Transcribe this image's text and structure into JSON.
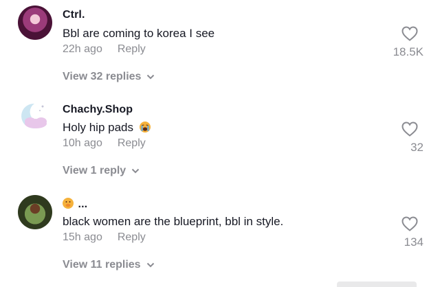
{
  "comments": [
    {
      "username": "Ctrl.",
      "text": "Bbl are coming to korea I see",
      "time": "22h ago",
      "reply_label": "Reply",
      "likes": "18.5K",
      "view_replies": "View 32 replies"
    },
    {
      "username": "Chachy.Shop",
      "text": "Holy hip pads",
      "time": "10h ago",
      "reply_label": "Reply",
      "likes": "32",
      "view_replies": "View 1 reply"
    },
    {
      "username": "...",
      "text": "black women are the blueprint, bbl in style.",
      "time": "15h ago",
      "reply_label": "Reply",
      "likes": "134",
      "view_replies": "View 11 replies"
    }
  ],
  "icons": {
    "like": "heart-outline-icon",
    "expand": "chevron-down-icon",
    "crying_emoji": "loudly-crying-face",
    "thinking_emoji": "face-with-hand-over-mouth"
  },
  "colors": {
    "primary_text": "#161823",
    "secondary_text": "#8a8b91",
    "background": "#ffffff"
  }
}
